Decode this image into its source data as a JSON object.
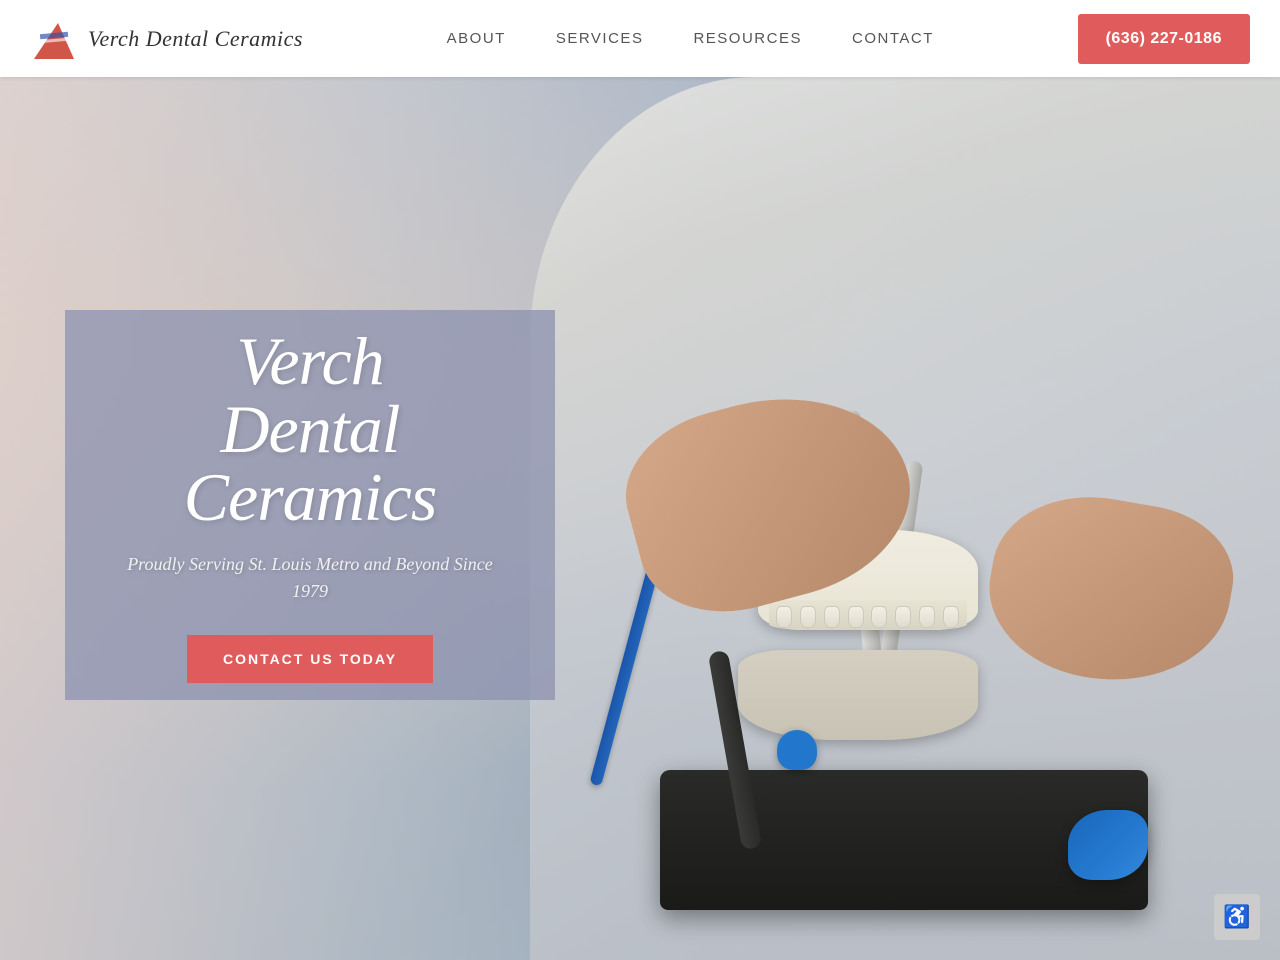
{
  "header": {
    "logo_text": "Verch Dental Ceramics",
    "nav": {
      "about": "ABOUT",
      "services": "SERVICES",
      "resources": "RESOURCES",
      "contact": "CONTACT"
    },
    "phone": "(636) 227-0186"
  },
  "hero": {
    "title_line1": "Verch",
    "title_line2": "Dental",
    "title_line3": "Ceramics",
    "subtitle": "Proudly Serving St. Louis Metro and Beyond Since 1979",
    "cta_button": "CONTACT US TODAY"
  },
  "accessibility": {
    "icon": "♿"
  }
}
